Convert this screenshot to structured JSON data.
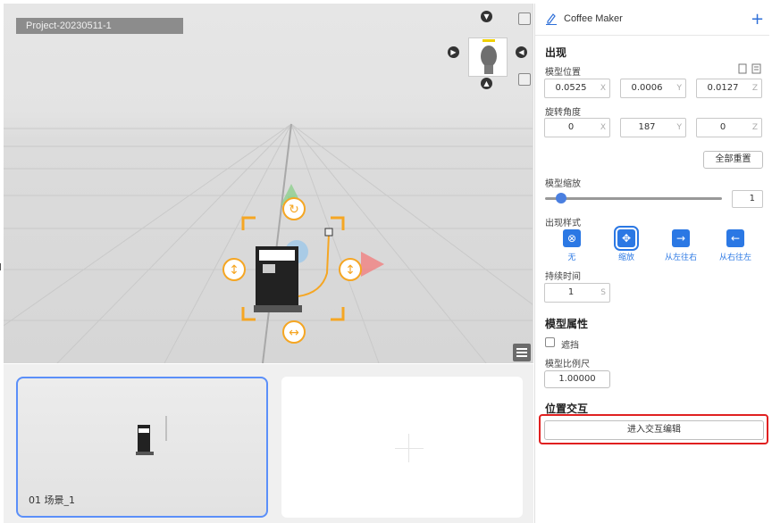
{
  "viewport": {
    "project_name": "Project-20230511-1"
  },
  "scenes": [
    {
      "label": "01  场景_1"
    }
  ],
  "panel": {
    "title": "Coffee Maker",
    "appear_section": "出现",
    "model_position_label": "模型位置",
    "position": [
      {
        "value": "0.0525",
        "axis": "X"
      },
      {
        "value": "0.0006",
        "axis": "Y"
      },
      {
        "value": "0.0127",
        "axis": "Z"
      }
    ],
    "rotation_label": "旋转角度",
    "rotation": [
      {
        "value": "0",
        "axis": "X"
      },
      {
        "value": "187",
        "axis": "Y"
      },
      {
        "value": "0",
        "axis": "Z"
      }
    ],
    "reset_all_label": "全部重置",
    "scale_label": "模型缩放",
    "scale_value": "1",
    "appear_style_label": "出现样式",
    "styles": [
      {
        "label": "无",
        "icon": "close-circle-icon",
        "glyph": "⊗"
      },
      {
        "label": "缩放",
        "icon": "expand-icon",
        "glyph": "✥"
      },
      {
        "label": "从左往右",
        "icon": "arrow-right-icon",
        "glyph": "→"
      },
      {
        "label": "从右往左",
        "icon": "arrow-left-icon",
        "glyph": "←"
      }
    ],
    "duration_label": "持续时间",
    "duration_value": "1",
    "duration_unit": "S",
    "model_props_section": "模型属性",
    "occlude_label": "遮挡",
    "model_scale_ratio_label": "模型比例尺",
    "model_scale_ratio_value": "1.00000",
    "interaction_section": "位置交互",
    "enter_interaction_label": "进入交互编辑"
  },
  "colors": {
    "accent": "#2b78e4",
    "highlight": "#e02020",
    "gizmo": "#f5a623"
  }
}
